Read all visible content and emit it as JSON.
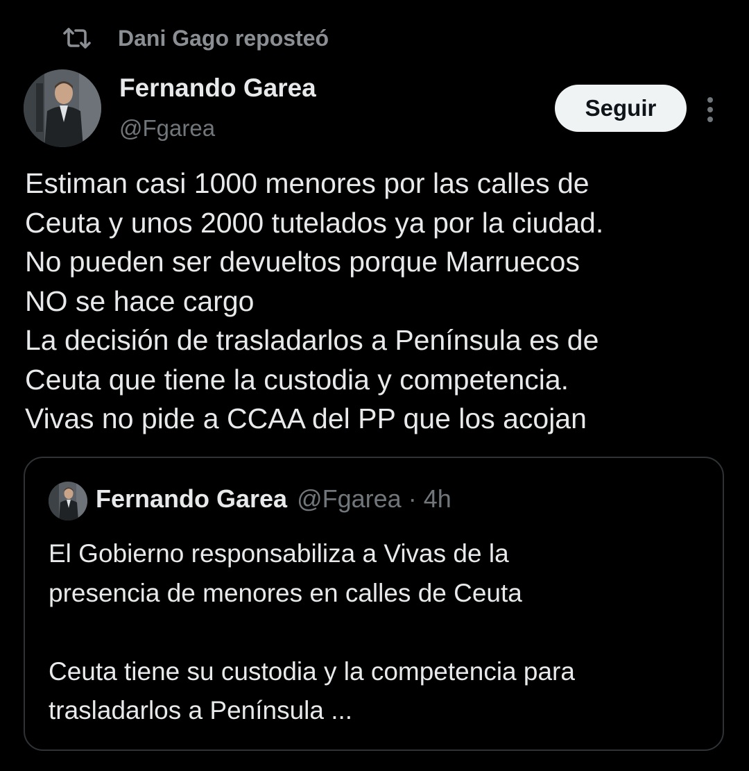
{
  "repost": {
    "icon": "repost-icon",
    "text": "Dani Gago reposteó"
  },
  "author": {
    "name": "Fernando Garea",
    "handle": "@Fgarea",
    "avatar_icon": "avatar"
  },
  "actions": {
    "follow_label": "Seguir",
    "more_icon": "more-vertical-icon"
  },
  "tweet": {
    "lines": [
      "Estiman casi 1000 menores por las calles de",
      "Ceuta y unos 2000 tutelados ya por la ciudad.",
      "No pueden ser devueltos porque Marruecos",
      "NO se hace cargo",
      "La decisión de trasladarlos a Península es de",
      "Ceuta que tiene la custodia y competencia.",
      "Vivas no pide a CCAA del PP que los acojan"
    ]
  },
  "quote": {
    "name": "Fernando Garea",
    "handle": "@Fgarea",
    "separator": "·",
    "time": "4h",
    "paragraph1": [
      "El Gobierno responsabiliza a Vivas de la",
      "presencia de menores en calles de Ceuta"
    ],
    "paragraph2": [
      "Ceuta tiene su custodia y la competencia para",
      "trasladarlos a Península ..."
    ]
  },
  "colors": {
    "background": "#000000",
    "text_primary": "#e7e9ea",
    "text_secondary": "#71767b",
    "repost_text": "#8b8f94",
    "follow_bg": "#eff3f4",
    "follow_text": "#0f1419",
    "border": "#2f3336"
  }
}
